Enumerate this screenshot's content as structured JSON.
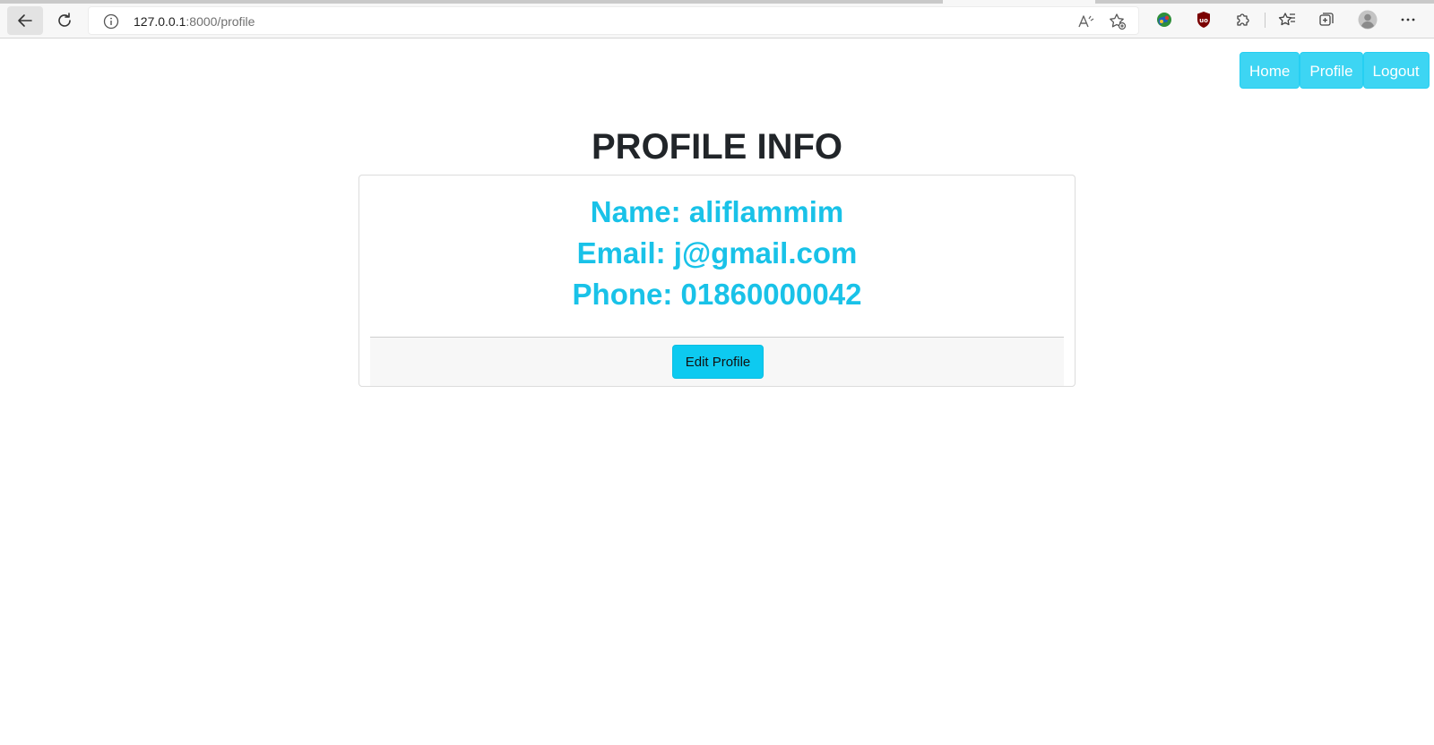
{
  "browser": {
    "url_host": "127.0.0.1",
    "url_path": ":8000/profile",
    "icons": {
      "back": "back-arrow-icon",
      "reload": "reload-icon",
      "site_info": "info-icon",
      "read_aloud": "read-aloud-icon",
      "add_favorite": "add-favorite-icon",
      "extension_1": "extension-globe-icon",
      "extension_2": "ublock-origin-icon",
      "extensions": "puzzle-icon",
      "favorites": "favorites-icon",
      "collections": "collections-icon",
      "profile": "profile-avatar-icon",
      "menu": "more-menu-icon"
    }
  },
  "nav": {
    "home": "Home",
    "profile": "Profile",
    "logout": "Logout"
  },
  "page": {
    "title": "PROFILE INFO"
  },
  "profile": {
    "name_line": "Name: aliflammim",
    "email_line": "Email: j@gmail.com",
    "phone_line": "Phone: 01860000042"
  },
  "actions": {
    "edit_profile": "Edit Profile"
  },
  "colors": {
    "accent": "#0dcaf0",
    "nav_button": "#3dd5f3",
    "profile_text": "#19c2e8",
    "title_text": "#212529"
  }
}
